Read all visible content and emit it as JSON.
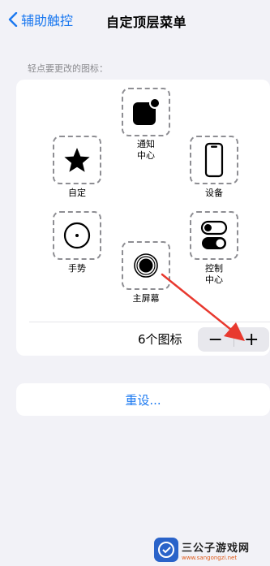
{
  "nav": {
    "back_label": "辅助触控",
    "title": "自定顶层菜单"
  },
  "section": {
    "label": "轻点要更改的图标："
  },
  "slots": {
    "notification": "通知\n中心",
    "custom": "自定",
    "device": "设备",
    "gesture": "手势",
    "control": "控制\n中心",
    "home": "主屏幕"
  },
  "footer": {
    "count": "6个图标",
    "minus": "−",
    "plus": "+"
  },
  "reset": {
    "label": "重设..."
  },
  "watermark": {
    "name": "三公子游戏网",
    "url": "www.sangongzi.net"
  },
  "colors": {
    "accent": "#1a78f0",
    "arrow": "#e8392f"
  },
  "icons": {
    "back": "chevron-left-icon",
    "notification": "notification-center-icon",
    "custom": "star-icon",
    "device": "iphone-icon",
    "gesture": "gesture-circle-icon",
    "control": "control-center-toggles-icon",
    "home": "home-button-icon"
  }
}
